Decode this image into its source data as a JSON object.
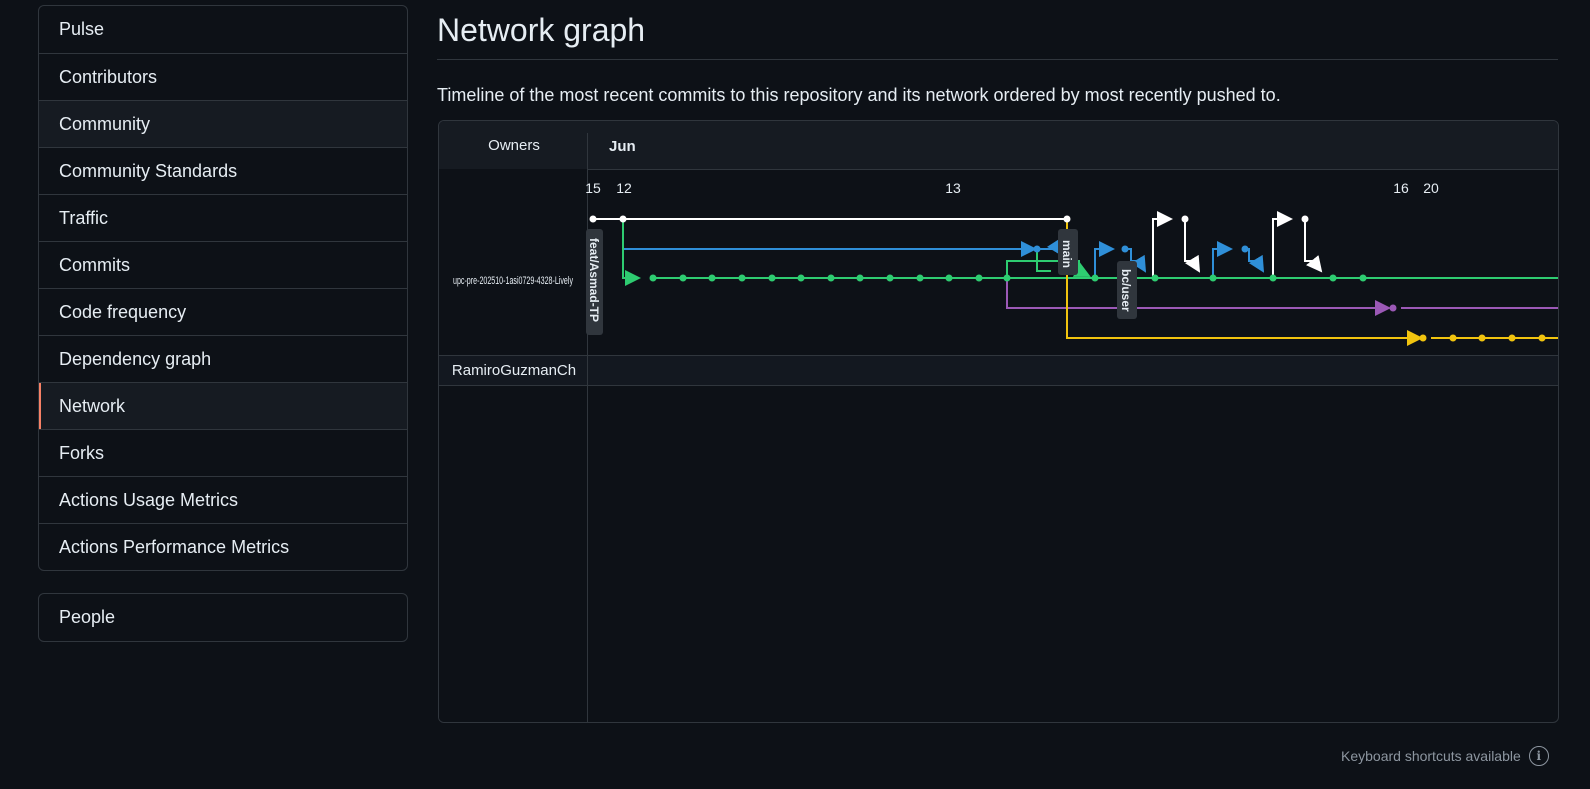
{
  "sidebar": {
    "items": [
      {
        "label": "Pulse"
      },
      {
        "label": "Contributors"
      },
      {
        "label": "Community"
      },
      {
        "label": "Community Standards"
      },
      {
        "label": "Traffic"
      },
      {
        "label": "Commits"
      },
      {
        "label": "Code frequency"
      },
      {
        "label": "Dependency graph"
      },
      {
        "label": "Network"
      },
      {
        "label": "Forks"
      },
      {
        "label": "Actions Usage Metrics"
      },
      {
        "label": "Actions Performance Metrics"
      }
    ],
    "selected": "Network",
    "hovered": "Community",
    "secondary": {
      "label": "People"
    }
  },
  "page": {
    "title": "Network graph",
    "description": "Timeline of the most recent commits to this repository and its network ordered by most recently pushed to."
  },
  "graph": {
    "owners_header": "Owners",
    "month_label": "Jun",
    "day_labels": [
      "15",
      "12",
      "13",
      "16",
      "20"
    ],
    "owners": [
      "upc-pre-202510-1asi0729-4328-Lively",
      "RamiroGuzmanCh"
    ],
    "branch_labels": [
      "feat/Asmad-TP",
      "main",
      "bc/user"
    ],
    "colors": {
      "white": "#ffffff",
      "blue": "#2f8fd8",
      "green": "#2ecc71",
      "purple": "#9b59b6",
      "yellow": "#f1c40f",
      "label_bg": "#30363d",
      "border": "#30363d"
    }
  },
  "footer": {
    "shortcuts_text": "Keyboard shortcuts available",
    "info_icon": "info-icon"
  }
}
